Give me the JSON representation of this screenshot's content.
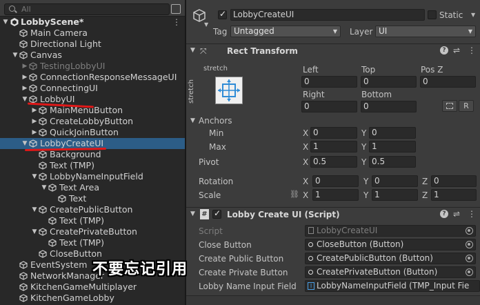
{
  "hierarchy": {
    "search_placeholder": "All",
    "rows": [
      {
        "label": "LobbyScene*",
        "depth": 0,
        "arrow": "down",
        "type": "scene"
      },
      {
        "label": "Main Camera",
        "depth": 1,
        "arrow": "none"
      },
      {
        "label": "Directional Light",
        "depth": 1,
        "arrow": "none"
      },
      {
        "label": "Canvas",
        "depth": 1,
        "arrow": "down"
      },
      {
        "label": "TestingLobbyUI",
        "depth": 2,
        "arrow": "right",
        "dimmed": true
      },
      {
        "label": "ConnectionResponseMessageUI",
        "depth": 2,
        "arrow": "right"
      },
      {
        "label": "ConnectingUI",
        "depth": 2,
        "arrow": "right"
      },
      {
        "label": "LobbyUI",
        "depth": 2,
        "arrow": "down"
      },
      {
        "label": "MainMenuButton",
        "depth": 3,
        "arrow": "right"
      },
      {
        "label": "CreateLobbyButton",
        "depth": 3,
        "arrow": "right"
      },
      {
        "label": "QuickJoinButton",
        "depth": 3,
        "arrow": "right"
      },
      {
        "label": "LobbyCreateUI",
        "depth": 2,
        "arrow": "down",
        "selected": true
      },
      {
        "label": "Background",
        "depth": 3,
        "arrow": "none"
      },
      {
        "label": "Text (TMP)",
        "depth": 3,
        "arrow": "none"
      },
      {
        "label": "LobbyNameInputField",
        "depth": 3,
        "arrow": "down"
      },
      {
        "label": "Text Area",
        "depth": 4,
        "arrow": "down"
      },
      {
        "label": "Text",
        "depth": 5,
        "arrow": "none"
      },
      {
        "label": "CreatePublicButton",
        "depth": 3,
        "arrow": "down"
      },
      {
        "label": "Text (TMP)",
        "depth": 4,
        "arrow": "none"
      },
      {
        "label": "CreatePrivateButton",
        "depth": 3,
        "arrow": "down"
      },
      {
        "label": "Text (TMP)",
        "depth": 4,
        "arrow": "none"
      },
      {
        "label": "CloseButton",
        "depth": 3,
        "arrow": "none"
      },
      {
        "label": "EventSystem",
        "depth": 1,
        "arrow": "none"
      },
      {
        "label": "NetworkManager",
        "depth": 1,
        "arrow": "none"
      },
      {
        "label": "KitchenGameMultiplayer",
        "depth": 1,
        "arrow": "none"
      },
      {
        "label": "KitchenGameLobby",
        "depth": 1,
        "arrow": "none"
      }
    ]
  },
  "inspector": {
    "object_name": "LobbyCreateUI",
    "static_label": "Static",
    "tag_label": "Tag",
    "tag_value": "Untagged",
    "layer_label": "Layer",
    "layer_value": "UI",
    "rect_transform": {
      "title": "Rect Transform",
      "anchor_preset_h": "stretch",
      "anchor_preset_v": "stretch",
      "left_label": "Left",
      "left_value": "0",
      "top_label": "Top",
      "top_value": "0",
      "posz_label": "Pos Z",
      "posz_value": "0",
      "right_label": "Right",
      "right_value": "0",
      "bottom_label": "Bottom",
      "bottom_value": "0",
      "r_button": "R",
      "anchors_label": "Anchors",
      "min_label": "Min",
      "min_x": "0",
      "min_y": "0",
      "max_label": "Max",
      "max_x": "1",
      "max_y": "1",
      "pivot_label": "Pivot",
      "pivot_x": "0.5",
      "pivot_y": "0.5",
      "rotation_label": "Rotation",
      "rot_x": "0",
      "rot_y": "0",
      "rot_z": "0",
      "scale_label": "Scale",
      "scale_x": "1",
      "scale_y": "1",
      "scale_z": "1",
      "x_axis": "X",
      "y_axis": "Y",
      "z_axis": "Z"
    },
    "script_component": {
      "title": "Lobby Create UI (Script)",
      "script_label": "Script",
      "script_value": "LobbyCreateUI",
      "close_label": "Close Button",
      "close_value": "CloseButton (Button)",
      "public_label": "Create Public Button",
      "public_value": "CreatePublicButton (Button)",
      "private_label": "Create Private Button",
      "private_value": "CreatePrivateButton (Button)",
      "input_label": "Lobby Name Input Field",
      "input_value": "LobbyNameInputField (TMP_Input Fie"
    }
  },
  "caption": "不要忘记引用",
  "colors": {
    "selection": "#2c5d87",
    "annotation_red": "#e01818"
  }
}
